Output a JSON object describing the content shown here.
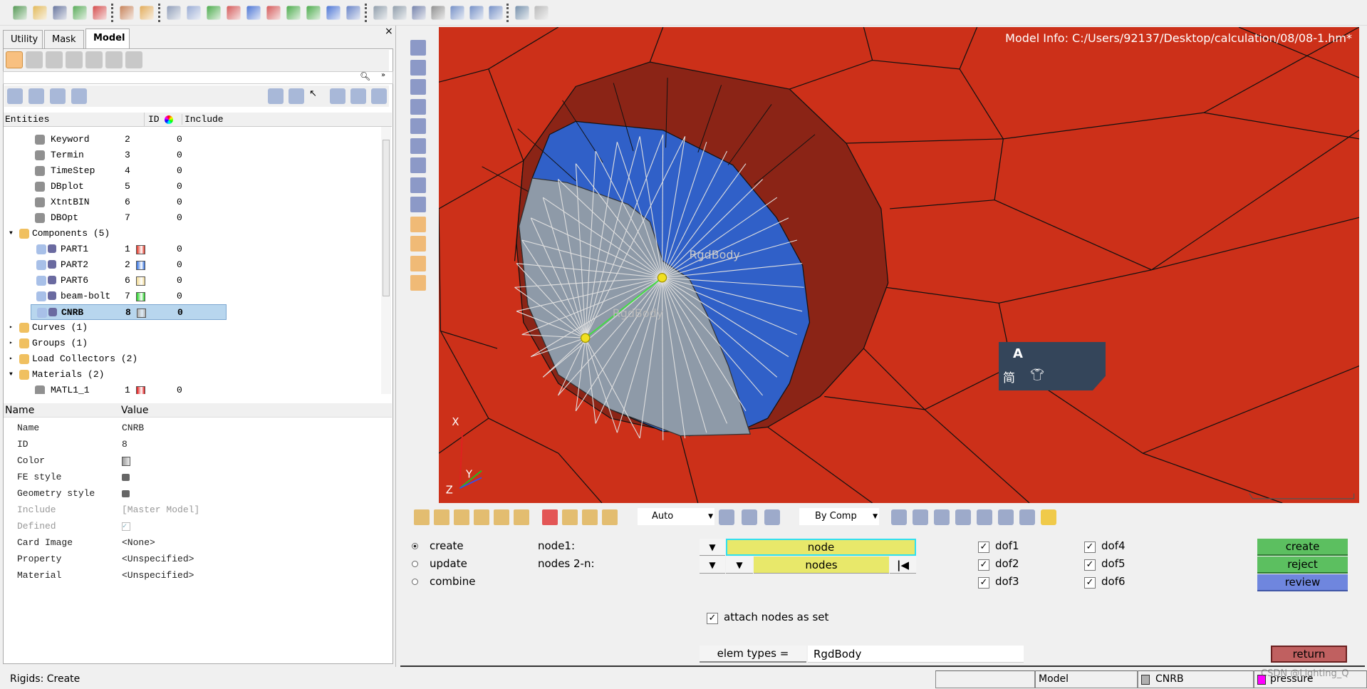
{
  "toolbar_top": {
    "icons": [
      "import-model-icon",
      "open-model-icon",
      "save-model-icon",
      "import-geometry-icon",
      "export-icon",
      "user-profile-icon",
      "color-palette-icon",
      "zoom-window-icon",
      "previous-view-icon",
      "view-xy-top-icon",
      "view-xy-bottom-icon",
      "view-xz-icon",
      "view-xz-back-icon",
      "view-yz-icon",
      "view-yz-left-icon",
      "view-iso-icon",
      "reset-view-icon",
      "zoom-in-icon",
      "zoom-out-icon",
      "pan-icon",
      "rotate-icon",
      "fit-horizontal-icon",
      "fit-vertical-icon",
      "spin-icon",
      "undo-icon",
      "redo-icon"
    ]
  },
  "left_panel": {
    "tabs": [
      {
        "label": "Utility"
      },
      {
        "label": "Mask"
      },
      {
        "label": "Model",
        "active": true
      }
    ],
    "search": {
      "value": "",
      "placeholder": ""
    },
    "table_headers": {
      "entities": "Entities",
      "id": "ID",
      "include": "Include"
    },
    "tree": [
      {
        "label": "Keyword",
        "id": "2",
        "include": "0",
        "level": 2,
        "icon": "card-icon"
      },
      {
        "label": "Termin",
        "id": "3",
        "include": "0",
        "level": 2,
        "icon": "card-icon"
      },
      {
        "label": "TimeStep",
        "id": "4",
        "include": "0",
        "level": 2,
        "icon": "card-icon"
      },
      {
        "label": "DBplot",
        "id": "5",
        "include": "0",
        "level": 2,
        "icon": "card-icon"
      },
      {
        "label": "XtntBIN",
        "id": "6",
        "include": "0",
        "level": 2,
        "icon": "card-icon"
      },
      {
        "label": "DBOpt",
        "id": "7",
        "include": "0",
        "level": 2,
        "icon": "card-icon"
      },
      {
        "label": "Components  (5)",
        "level": 1,
        "icon": "components-folder-icon",
        "expanded": true
      },
      {
        "label": "PART1",
        "id": "1",
        "include": "0",
        "level": 2,
        "icon": "component-icon",
        "color": "#e03020"
      },
      {
        "label": "PART2",
        "id": "2",
        "include": "0",
        "level": 2,
        "icon": "component-icon",
        "color": "#3070e0"
      },
      {
        "label": "PART6",
        "id": "6",
        "include": "0",
        "level": 2,
        "icon": "component-icon",
        "color": "#f0d890"
      },
      {
        "label": "beam-bolt",
        "id": "7",
        "include": "0",
        "level": 2,
        "icon": "component-icon",
        "color": "#20d020"
      },
      {
        "label": "CNRB",
        "id": "8",
        "include": "0",
        "level": 2,
        "icon": "component-icon",
        "color": "#b0b0b0",
        "selected": true
      },
      {
        "label": "Curves  (1)",
        "level": 1,
        "icon": "curves-folder-icon"
      },
      {
        "label": "Groups  (1)",
        "level": 1,
        "icon": "groups-folder-icon"
      },
      {
        "label": "Load Collectors  (2)",
        "level": 1,
        "icon": "load-collectors-folder-icon"
      },
      {
        "label": "Materials  (2)",
        "level": 1,
        "icon": "materials-folder-icon",
        "expanded": true
      },
      {
        "label": "MATL1_1",
        "id": "1",
        "include": "0",
        "level": 2,
        "icon": "material-icon",
        "color": "#e01010"
      }
    ],
    "props_headers": {
      "name": "Name",
      "value": "Value"
    },
    "props": [
      {
        "name": "Name",
        "value": "CNRB"
      },
      {
        "name": "ID",
        "value": "8"
      },
      {
        "name": "Color",
        "value": "",
        "swatch": "#b0b0b0"
      },
      {
        "name": "FE style",
        "value": "",
        "icon": "fe-style-icon"
      },
      {
        "name": "Geometry style",
        "value": "",
        "icon": "geometry-style-icon"
      },
      {
        "name": "Include",
        "value": "[Master Model]",
        "disabled": true
      },
      {
        "name": "Defined",
        "value": "",
        "checkbox": true,
        "disabled": true
      },
      {
        "name": "Card Image",
        "value": "<None>"
      },
      {
        "name": "Property",
        "value": "<Unspecified>"
      },
      {
        "name": "Material",
        "value": "<Unspecified>"
      }
    ]
  },
  "viewport": {
    "model_info": "Model Info: C:/Users/92137/Desktop/calculation/08/08-1.hm*",
    "labels": [
      "RgdBody",
      "RgdBody"
    ],
    "axes": {
      "x": "X",
      "y": "Y",
      "z": "Z"
    },
    "ime": {
      "mode": "A",
      "lang": "简"
    },
    "colors": {
      "part1": "#cc3019",
      "part2": "#3060c8",
      "flange": "#8b2416",
      "rigid": "#8e9aa8"
    }
  },
  "bottom_toolbar": {
    "auto_select": "Auto",
    "color_mode": "By Comp"
  },
  "panel": {
    "modes": [
      {
        "label": "create",
        "selected": true
      },
      {
        "label": "update"
      },
      {
        "label": "combine"
      }
    ],
    "node1_label": "node1:",
    "nodes2n_label": "nodes 2-n:",
    "node_field": "node",
    "nodes_field": "nodes",
    "dofs": [
      {
        "label": "dof1",
        "checked": true
      },
      {
        "label": "dof2",
        "checked": true
      },
      {
        "label": "dof3",
        "checked": true
      },
      {
        "label": "dof4",
        "checked": true
      },
      {
        "label": "dof5",
        "checked": true
      },
      {
        "label": "dof6",
        "checked": true
      }
    ],
    "attach_label": "attach nodes as set",
    "attach_checked": true,
    "elem_types_label": "elem types =",
    "elem_types_value": "RgdBody",
    "buttons": {
      "create": "create",
      "reject": "reject",
      "review": "review",
      "return": "return"
    },
    "button_colors": {
      "green": "#5cbf60",
      "blue": "#6f86de",
      "red": "#c06060"
    }
  },
  "status": {
    "message": "Rigids: Create",
    "model": "Model",
    "component": "CNRB",
    "load_collector": "pressure",
    "watermark": "CSDN @Lighting_Q"
  }
}
